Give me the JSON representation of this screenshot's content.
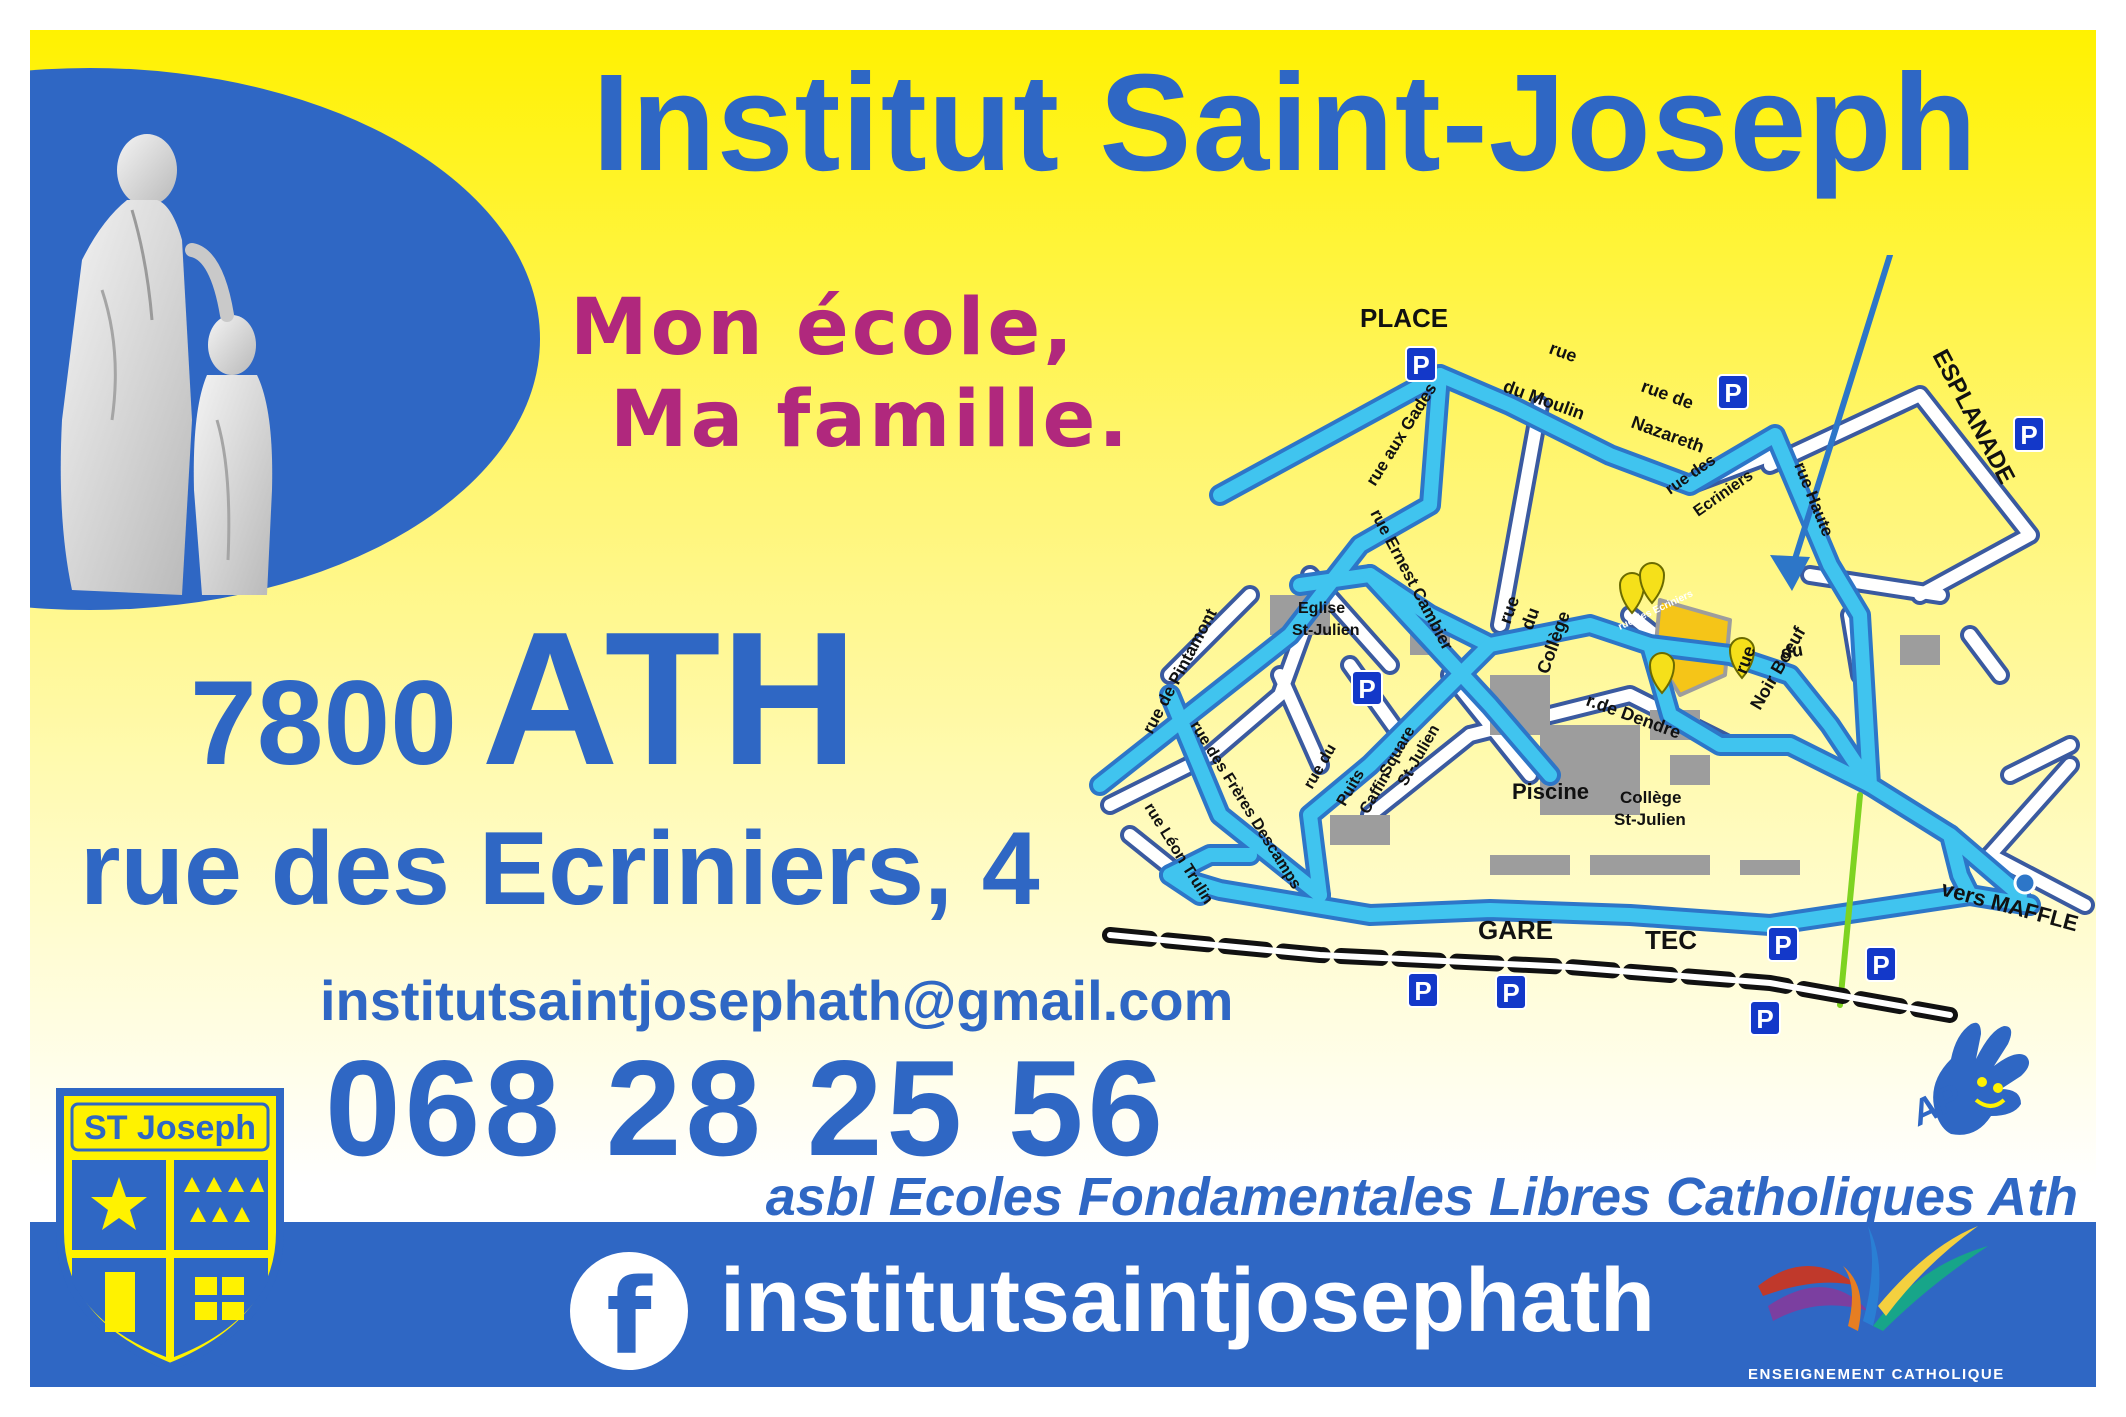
{
  "header": {
    "title": "Institut Saint-Joseph",
    "slogan_line1": "Mon école,",
    "slogan_line2": "Ma famille."
  },
  "address": {
    "postcode": "7800",
    "city": "ATH",
    "street": "rue des Ecriniers, 4"
  },
  "contact": {
    "email": "institutsaintjosephath@gmail.com",
    "phone": "068 28 25 56"
  },
  "organization": "asbl Ecoles Fondamentales Libres Catholiques Ath",
  "facebook": {
    "icon": "f",
    "handle": "institutsaintjosephath"
  },
  "shield_logo": {
    "text": "ST Joseph"
  },
  "catholic_logo": {
    "text": "ENSEIGNEMENT CATHOLIQUE"
  },
  "ap_logo": {
    "text": "AP"
  },
  "map": {
    "labels": {
      "place": "PLACE",
      "rue_moulin_1": "rue",
      "rue_moulin_2": "du Moulin",
      "rue_nazareth_1": "rue de",
      "rue_nazareth_2": "Nazareth",
      "rue_ecriniers_1": "rue des",
      "rue_ecriniers_2": "Ecriniers",
      "rue_ecriniers_small": "rue des Ecriniers",
      "esplanade": "ESPLANADE",
      "rue_gades": "rue aux Gades",
      "rue_haute": "rue Haute",
      "rue_ernest": "rue Ernest Cambier",
      "eglise_1": "Eglise",
      "eglise_2": "St-Julien",
      "rue_college_1": "rue",
      "rue_college_2": "du",
      "rue_college_3": "Collège",
      "rue_noir_1": "rue",
      "rue_noir_2": "du",
      "rue_noir_3": "Noir Boeuf",
      "rue_pintamont": "rue de Pintamont",
      "rue_dendre": "r.de Dendre",
      "rue_freres": "rue des Frères Descamps",
      "rue_puits_1": "rue du",
      "rue_puits_2": "Puits",
      "rue_puits_3": "Caffin",
      "square_1": "Square",
      "square_2": "St-Julien",
      "piscine": "Piscine",
      "college_1": "Collège",
      "college_2": "St-Julien",
      "rue_leon": "rue Léon Trulin",
      "maffle": "vers MAFFLE",
      "gare": "GARE",
      "tec": "TEC",
      "parking": "P"
    }
  },
  "colors": {
    "brand_blue": "#2f67c4",
    "slogan_magenta": "#b0287d",
    "yellow": "#fff200",
    "route_cyan": "#39b3e6"
  }
}
